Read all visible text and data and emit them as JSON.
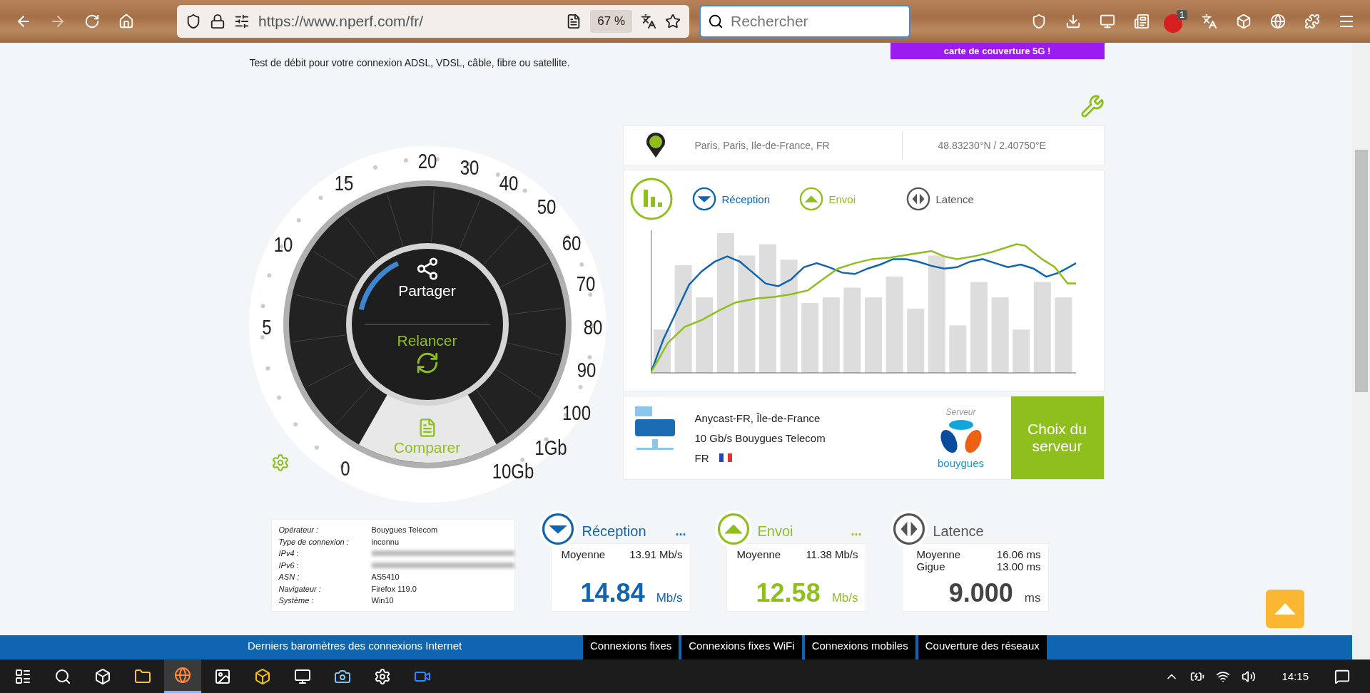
{
  "browser": {
    "url": "https://www.nperf.com/fr/",
    "zoom": "67 %",
    "search_placeholder": "Rechercher",
    "adblock_badge": "1"
  },
  "page": {
    "subtitle": "Test de débit pour votre connexion ADSL, VDSL, câble, fibre ou satellite.",
    "promo": "carte de couverture 5G !"
  },
  "gauge": {
    "scale": [
      "0",
      "5",
      "10",
      "15",
      "20",
      "30",
      "40",
      "50",
      "60",
      "70",
      "80",
      "90",
      "100",
      "1Gb",
      "10Gb"
    ],
    "share": "Partager",
    "restart": "Relancer",
    "compare": "Comparer"
  },
  "location": {
    "place": "Paris, Paris, Ile-de-France, FR",
    "coords": "48.83230°N / 2.40750°E"
  },
  "legend": [
    {
      "kind": "download",
      "label": "Réception"
    },
    {
      "kind": "upload",
      "label": "Envoi"
    },
    {
      "kind": "latency",
      "label": "Latence"
    }
  ],
  "server": {
    "name": "Anycast-FR, Île-de-France",
    "detail": "10 Gb/s Bouygues Telecom",
    "country": "FR",
    "caption": "Serveur",
    "logo_text": "bouygues",
    "button": "Choix du serveur"
  },
  "info": [
    {
      "label": "Opérateur :",
      "value": "Bouygues Telecom",
      "blurred": false
    },
    {
      "label": "Type de connexion :",
      "value": "inconnu",
      "blurred": false
    },
    {
      "label": "IPv4 :",
      "blurred": true
    },
    {
      "label": "IPv6 :",
      "blurred": true
    },
    {
      "label": "ASN :",
      "value": "AS5410",
      "blurred": false
    },
    {
      "label": "Navigateur :",
      "value": "Firefox 119.0",
      "blurred": false
    },
    {
      "label": "Système :",
      "value": "Win10",
      "blurred": false
    }
  ],
  "results": [
    {
      "kind": "download",
      "title": "Réception",
      "more": "...",
      "rows": [
        {
          "label": "Moyenne",
          "value": "13.91 Mb/s"
        }
      ],
      "value": "14.84",
      "unit": "Mb/s"
    },
    {
      "kind": "upload",
      "title": "Envoi",
      "more": "...",
      "rows": [
        {
          "label": "Moyenne",
          "value": "11.38 Mb/s"
        }
      ],
      "value": "12.58",
      "unit": "Mb/s"
    },
    {
      "kind": "latency",
      "title": "Latence",
      "rows": [
        {
          "label": "Moyenne",
          "value": "16.06 ms"
        },
        {
          "label": "Gigue",
          "value": "13.00 ms"
        }
      ],
      "value": "9.000",
      "unit": "ms"
    }
  ],
  "footer": {
    "text": "Derniers baromètres des connexions Internet",
    "tabs": [
      "Connexions fixes",
      "Connexions fixes WiFi",
      "Connexions mobiles",
      "Couverture des réseaux"
    ]
  },
  "taskbar": {
    "time": "14:15"
  }
}
